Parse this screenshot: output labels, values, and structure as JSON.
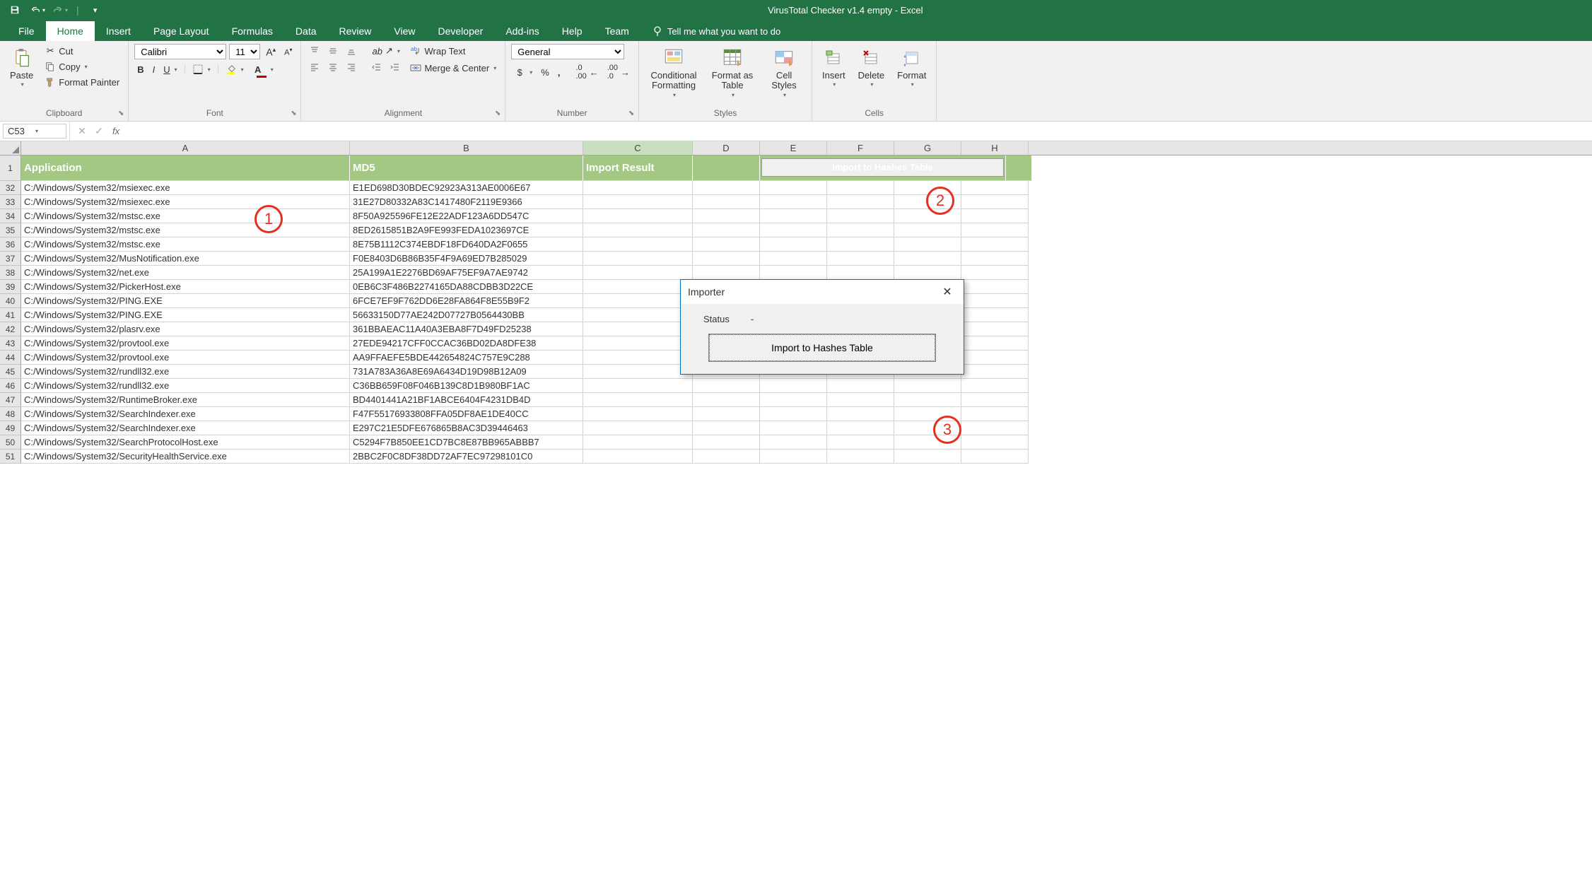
{
  "title": "VirusTotal Checker v1.4 empty  -  Excel",
  "qat": {
    "save": "💾",
    "undo": "↶",
    "redo": "↷",
    "more": "▾"
  },
  "tabs": [
    "File",
    "Home",
    "Insert",
    "Page Layout",
    "Formulas",
    "Data",
    "Review",
    "View",
    "Developer",
    "Add-ins",
    "Help",
    "Team"
  ],
  "active_tab": 1,
  "tellme": "Tell me what you want to do",
  "ribbon": {
    "clipboard": {
      "label": "Clipboard",
      "paste": "Paste",
      "cut": "Cut",
      "copy": "Copy",
      "fmt": "Format Painter"
    },
    "font": {
      "label": "Font",
      "name": "Calibri",
      "size": "11",
      "bold": "B",
      "italic": "I",
      "underline": "U"
    },
    "alignment": {
      "label": "Alignment",
      "wrap": "Wrap Text",
      "merge": "Merge & Center"
    },
    "number": {
      "label": "Number",
      "format": "General"
    },
    "styles": {
      "label": "Styles",
      "cond": "Conditional Formatting",
      "fat": "Format as Table",
      "cell": "Cell Styles"
    },
    "cells": {
      "label": "Cells",
      "insert": "Insert",
      "delete": "Delete",
      "format": "Format"
    }
  },
  "namebox": "C53",
  "columns": [
    "A",
    "B",
    "C",
    "D",
    "E",
    "F",
    "G",
    "H"
  ],
  "col_classes": [
    "cA",
    "cB",
    "cC",
    "cD",
    "cE",
    "cF",
    "cG",
    "cH"
  ],
  "selected_col": "C",
  "headers": {
    "A": "Application",
    "B": "MD5",
    "C": "Import Result"
  },
  "import_btn": "Import to Hashes Table",
  "rows": [
    {
      "n": 32,
      "a": "C:/Windows/System32/msiexec.exe",
      "b": "E1ED698D30BDEC92923A313AE0006E67"
    },
    {
      "n": 33,
      "a": "C:/Windows/System32/msiexec.exe",
      "b": "31E27D80332A83C1417480F2119E9366"
    },
    {
      "n": 34,
      "a": "C:/Windows/System32/mstsc.exe",
      "b": "8F50A925596FE12E22ADF123A6DD547C"
    },
    {
      "n": 35,
      "a": "C:/Windows/System32/mstsc.exe",
      "b": "8ED2615851B2A9FE993FEDA1023697CE"
    },
    {
      "n": 36,
      "a": "C:/Windows/System32/mstsc.exe",
      "b": "8E75B1112C374EBDF18FD640DA2F0655"
    },
    {
      "n": 37,
      "a": "C:/Windows/System32/MusNotification.exe",
      "b": "F0E8403D6B86B35F4F9A69ED7B285029"
    },
    {
      "n": 38,
      "a": "C:/Windows/System32/net.exe",
      "b": "25A199A1E2276BD69AF75EF9A7AE9742"
    },
    {
      "n": 39,
      "a": "C:/Windows/System32/PickerHost.exe",
      "b": "0EB6C3F486B2274165DA88CDBB3D22CE"
    },
    {
      "n": 40,
      "a": "C:/Windows/System32/PING.EXE",
      "b": "6FCE7EF9F762DD6E28FA864F8E55B9F2"
    },
    {
      "n": 41,
      "a": "C:/Windows/System32/PING.EXE",
      "b": "56633150D77AE242D07727B0564430BB"
    },
    {
      "n": 42,
      "a": "C:/Windows/System32/plasrv.exe",
      "b": "361BBAEAC11A40A3EBA8F7D49FD25238"
    },
    {
      "n": 43,
      "a": "C:/Windows/System32/provtool.exe",
      "b": "27EDE94217CFF0CCAC36BD02DA8DFE38"
    },
    {
      "n": 44,
      "a": "C:/Windows/System32/provtool.exe",
      "b": "AA9FFAEFE5BDE442654824C757E9C288"
    },
    {
      "n": 45,
      "a": "C:/Windows/System32/rundll32.exe",
      "b": "731A783A36A8E69A6434D19D98B12A09"
    },
    {
      "n": 46,
      "a": "C:/Windows/System32/rundll32.exe",
      "b": "C36BB659F08F046B139C8D1B980BF1AC"
    },
    {
      "n": 47,
      "a": "C:/Windows/System32/RuntimeBroker.exe",
      "b": "BD4401441A21BF1ABCE6404F4231DB4D"
    },
    {
      "n": 48,
      "a": "C:/Windows/System32/SearchIndexer.exe",
      "b": "F47F55176933808FFA05DF8AE1DE40CC"
    },
    {
      "n": 49,
      "a": "C:/Windows/System32/SearchIndexer.exe",
      "b": "E297C21E5DFE676865B8AC3D39446463"
    },
    {
      "n": 50,
      "a": "C:/Windows/System32/SearchProtocolHost.exe",
      "b": "C5294F7B850EE1CD7BC8E87BB965ABBB7"
    },
    {
      "n": 51,
      "a": "C:/Windows/System32/SecurityHealthService.exe",
      "b": "2BBC2F0C8DF38DD72AF7EC97298101C0"
    }
  ],
  "dialog": {
    "title": "Importer",
    "status_lbl": "Status",
    "status_val": "-",
    "btn": "Import to Hashes Table"
  },
  "anno": [
    "1",
    "2",
    "3"
  ]
}
